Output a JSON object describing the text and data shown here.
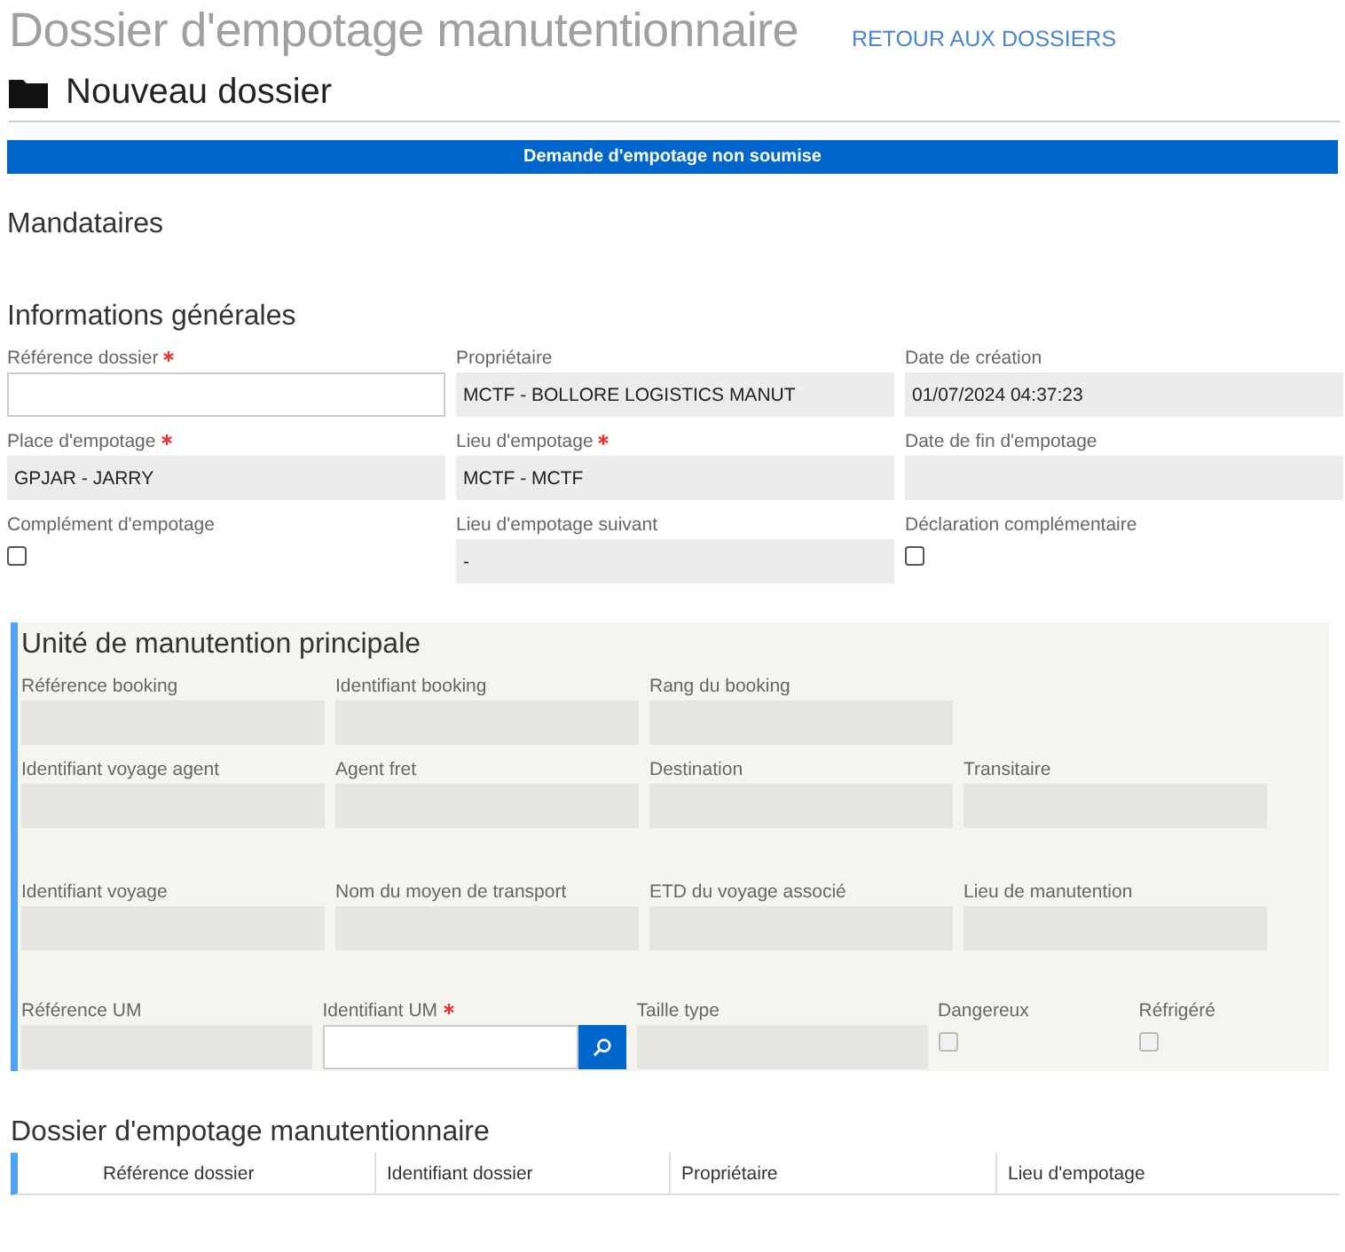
{
  "header": {
    "title": "Dossier d'empotage manutentionnaire",
    "back_link": "RETOUR AUX DOSSIERS"
  },
  "subtitle": "Nouveau dossier",
  "status_banner": "Demande d'empotage non soumise",
  "mandataires": {
    "title": "Mandataires"
  },
  "general_info": {
    "title": "Informations générales",
    "rows": [
      [
        {
          "kind": "text",
          "label": "Référence dossier",
          "required": true,
          "editable": true
        },
        {
          "kind": "text",
          "label": "Propriétaire",
          "required": false,
          "editable": false,
          "value": "MCTF - BOLLORE LOGISTICS MANUT"
        },
        {
          "kind": "text",
          "label": "Date de création",
          "required": false,
          "editable": false,
          "value": "01/07/2024 04:37:23"
        }
      ],
      [
        {
          "kind": "text",
          "label": "Place d'empotage",
          "required": true,
          "editable": false,
          "value": "GPJAR - JARRY"
        },
        {
          "kind": "text",
          "label": "Lieu d'empotage",
          "required": true,
          "editable": false,
          "value": "MCTF - MCTF"
        },
        {
          "kind": "text",
          "label": "Date de fin d'empotage",
          "required": false,
          "editable": false
        }
      ],
      [
        {
          "kind": "checkbox",
          "label": "Complément d'empotage",
          "checked": false,
          "disabled": false
        },
        {
          "kind": "text",
          "label": "Lieu d'empotage suivant",
          "required": false,
          "editable": false,
          "value": "-"
        },
        {
          "kind": "checkbox",
          "label": "Déclaration complémentaire",
          "checked": false,
          "disabled": false
        }
      ]
    ]
  },
  "main_unit": {
    "title": "Unité de manutention principale",
    "rows": [
      [
        {
          "kind": "text",
          "label": "Référence booking",
          "required": false,
          "editable": false
        },
        {
          "kind": "text",
          "label": "Identifiant booking",
          "required": false,
          "editable": false
        },
        {
          "kind": "text",
          "label": "Rang du booking",
          "required": false,
          "editable": false
        }
      ],
      [
        {
          "kind": "text",
          "label": "Identifiant voyage agent",
          "required": false,
          "editable": false
        },
        {
          "kind": "text",
          "label": "Agent fret",
          "required": false,
          "editable": false
        },
        {
          "kind": "text",
          "label": "Destination",
          "required": false,
          "editable": false
        },
        {
          "kind": "text",
          "label": "Transitaire",
          "required": false,
          "editable": false
        }
      ],
      [
        {
          "kind": "text",
          "label": "Identifiant voyage",
          "required": false,
          "editable": false
        },
        {
          "kind": "text",
          "label": "Nom du moyen de transport",
          "required": false,
          "editable": false
        },
        {
          "kind": "text",
          "label": "ETD du voyage associé",
          "required": false,
          "editable": false
        },
        {
          "kind": "text",
          "label": "Lieu de manutention",
          "required": false,
          "editable": false
        }
      ],
      [
        {
          "kind": "text",
          "label": "Référence UM",
          "required": false,
          "editable": false
        },
        {
          "kind": "lookup",
          "label": "Identifiant UM",
          "required": true,
          "editable": true
        },
        {
          "kind": "text",
          "label": "Taille type",
          "required": false,
          "editable": false
        },
        {
          "kind": "checkbox",
          "label": "Dangereux",
          "checked": false,
          "disabled": true
        },
        {
          "kind": "checkbox",
          "label": "Réfrigéré",
          "checked": false,
          "disabled": true
        }
      ]
    ]
  },
  "dossiers_table": {
    "title": "Dossier d'empotage manutentionnaire",
    "columns": [
      "Référence dossier",
      "Identifiant dossier",
      "Propriétaire",
      "Lieu d'empotage"
    ]
  }
}
